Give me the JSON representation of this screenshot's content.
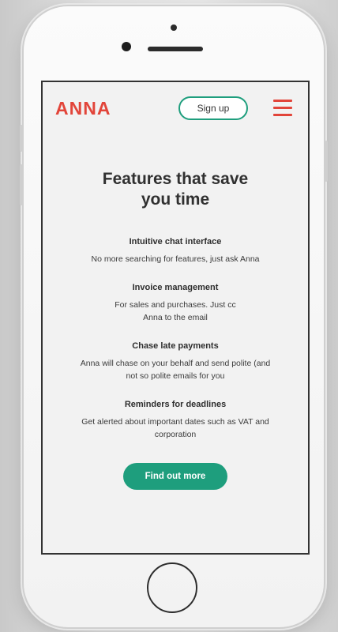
{
  "header": {
    "logo_text": "ANNA",
    "signup_label": "Sign up",
    "menu_icon": "hamburger-menu-icon"
  },
  "main": {
    "title": "Features that save you time",
    "features": [
      {
        "heading": "Intuitive chat interface",
        "text": "No more searching for features, just ask Anna"
      },
      {
        "heading": "Invoice management",
        "text": "For sales and purchases. Just cc Anna to the email"
      },
      {
        "heading": "Chase late payments",
        "text": "Anna will chase on your behalf and send polite (and not so polite emails for you"
      },
      {
        "heading": "Reminders for deadlines",
        "text": "Get alerted about important dates such as VAT and corporation"
      }
    ],
    "cta_label": "Find out more"
  },
  "colors": {
    "brand_red": "#e2453a",
    "brand_green": "#1e9e7d",
    "screen_bg": "#f2f2f2"
  }
}
